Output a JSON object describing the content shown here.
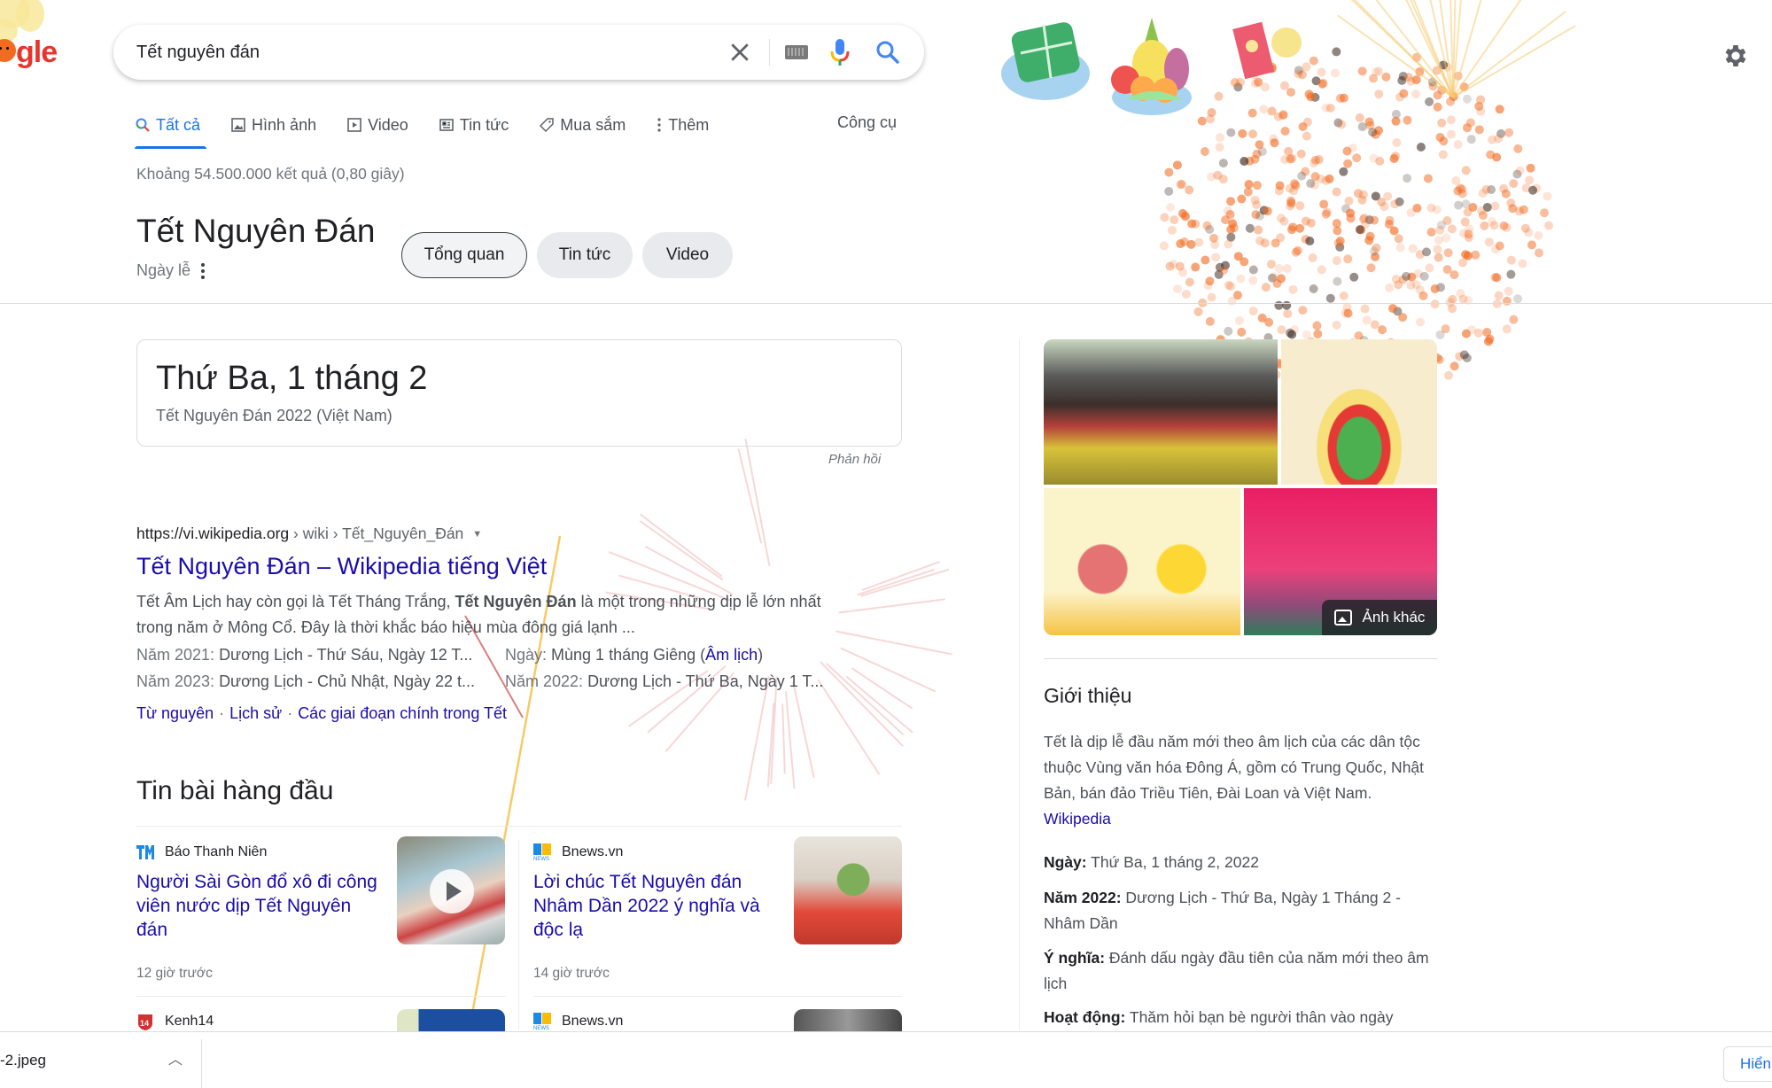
{
  "logo": {
    "text": "gle",
    "alt": "Google doodle - Tet 2022"
  },
  "search": {
    "query": "Tết nguyên đán"
  },
  "tabs": [
    {
      "label": "Tất cả",
      "icon": "search-icon",
      "active": true
    },
    {
      "label": "Hình ảnh",
      "icon": "image-icon",
      "active": false
    },
    {
      "label": "Video",
      "icon": "video-icon",
      "active": false
    },
    {
      "label": "Tin tức",
      "icon": "news-icon",
      "active": false
    },
    {
      "label": "Mua sắm",
      "icon": "tag-icon",
      "active": false
    },
    {
      "label": "Thêm",
      "icon": "more-vert-icon",
      "active": false
    }
  ],
  "tools_label": "Công cụ",
  "stats": "Khoảng 54.500.000 kết quả (0,80 giây)",
  "entity": {
    "title": "Tết Nguyên Đán",
    "subtitle": "Ngày lễ",
    "chips": [
      "Tổng quan",
      "Tin tức",
      "Video"
    ]
  },
  "date_card": {
    "date": "Thứ Ba, 1 tháng 2",
    "caption": "Tết Nguyên Đán 2022 (Việt Nam)",
    "feedback": "Phản hồi"
  },
  "result": {
    "cite_domain": "https://vi.wikipedia.org",
    "cite_path": " › wiki › Tết_Nguyên_Đán",
    "title": "Tết Nguyên Đán – Wikipedia tiếng Việt",
    "snippet_pre": "Tết Âm Lịch hay còn gọi là Tết Tháng Trắng, ",
    "snippet_bold": "Tết Nguyên Đán",
    "snippet_post": " là một trong những dịp lễ lớn nhất trong năm ở Mông Cổ. Đây là thời khắc báo hiệu mùa đông giá lạnh ...",
    "facts": [
      {
        "label": "Năm 2021: ",
        "value": "Dương Lịch - Thứ Sáu, Ngày 12 T..."
      },
      {
        "label": "Ngày: ",
        "value": "Mùng 1 tháng Giêng (",
        "link": "Âm lịch",
        "tail": ")"
      },
      {
        "label": "Năm 2023: ",
        "value": "Dương Lịch - Chủ Nhật, Ngày 22 t..."
      },
      {
        "label": "Năm 2022: ",
        "value": "Dương Lịch - Thứ Ba, Ngày 1 T..."
      }
    ],
    "sitelinks": [
      "Từ nguyên",
      "Lịch sử",
      "Các giai đoạn chính trong Tết"
    ]
  },
  "top_stories": {
    "title": "Tin bài hàng đầu",
    "items": [
      {
        "source": "Báo Thanh Niên",
        "headline": "Người Sài Gòn đổ xô đi công viên nước dịp Tết Nguyên đán",
        "age": "12 giờ trước",
        "has_video": true
      },
      {
        "source": "Bnews.vn",
        "headline": "Lời chúc Tết Nguyên đán Nhâm Dần 2022 ý nghĩa và độc lạ",
        "age": "14 giờ trước",
        "has_video": false
      },
      {
        "source": "Kenh14",
        "headline": "",
        "age": ""
      },
      {
        "source": "Bnews.vn",
        "headline": "",
        "age": ""
      }
    ]
  },
  "knowledge_panel": {
    "more_images": "Ảnh khác",
    "about_title": "Giới thiệu",
    "description": "Tết là dịp lễ đầu năm mới theo âm lịch của các dân tộc thuộc Vùng văn hóa Đông Á, gồm có Trung Quốc, Nhật Bản, bán đảo Triều Tiên, Đài Loan và Việt Nam. ",
    "source_link": "Wikipedia",
    "facts": [
      {
        "label": "Ngày:",
        "value": " Thứ Ba, 1 tháng 2, 2022"
      },
      {
        "label": "Năm 2022:",
        "value": " Dương Lịch - Thứ Ba, Ngày 1 Tháng 2 - Nhâm Dần"
      },
      {
        "label": "Ý nghĩa:",
        "value": " Đánh dấu ngày đầu tiên của năm mới theo âm lịch"
      },
      {
        "label": "Hoạt động:",
        "value": " Thăm hỏi bạn bè người thân vào ngày"
      }
    ]
  },
  "download_bar": {
    "file_name": "-2.jpeg",
    "show_all": "Hiển"
  },
  "colors": {
    "accent": "#1a73e8",
    "link": "#1a0dab",
    "text": "#202124",
    "muted": "#70757a"
  }
}
